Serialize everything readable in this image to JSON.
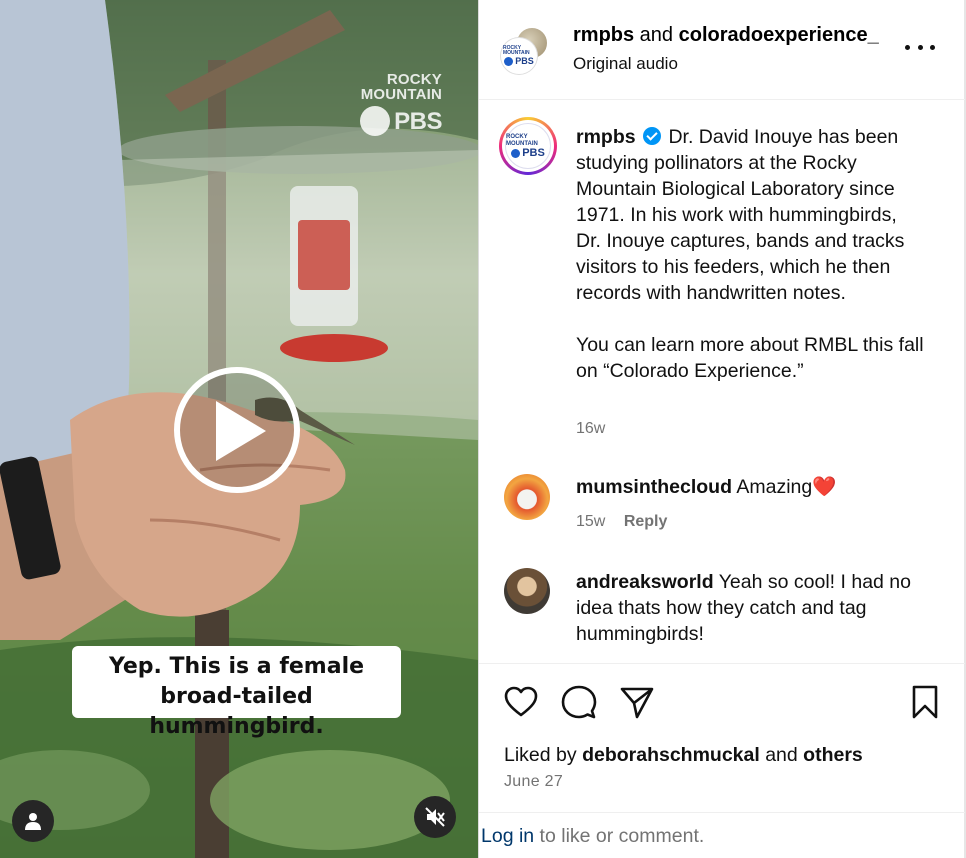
{
  "video": {
    "watermark": {
      "line1": "ROCKY",
      "line2": "MOUNTAIN",
      "brand": "PBS"
    },
    "caption_line1": "Yep. This is a female",
    "caption_line2": "broad-tailed hummingbird.",
    "icons": {
      "play": "play-icon",
      "tags": "user-tag-icon",
      "mute": "speaker-muted-icon"
    }
  },
  "header": {
    "account1": "rmpbs",
    "joiner": " and ",
    "account2": "coloradoexperience_",
    "audio": "Original audio",
    "more_icon": "more-horizontal-icon",
    "avatar_text_top": "ROCKY MOUNTAIN",
    "avatar_text_brand": "PBS"
  },
  "post": {
    "username": "rmpbs",
    "verified_icon": "verified-badge-icon",
    "paragraph1": "Dr. David Inouye has been studying pollinators at the Rocky Mountain Biological Laboratory since 1971. In his work with hummingbirds, Dr. Inouye captures, bands and tracks visitors to his feeders, which he then records with handwritten notes.",
    "paragraph2": "You can learn more about RMBL this fall on “Colorado Experience.”",
    "time": "16w"
  },
  "comments": [
    {
      "username": "mumsinthecloud",
      "text": "Amazing",
      "emoji": "❤️",
      "time": "15w",
      "reply": "Reply"
    },
    {
      "username": "andreaksworld",
      "text": "Yeah so cool! I had no idea thats how they catch and tag hummingbirds!"
    }
  ],
  "actions": {
    "like": "heart-icon",
    "comment": "comment-bubble-icon",
    "share": "paper-plane-icon",
    "save": "bookmark-icon"
  },
  "likes": {
    "prefix": "Liked by ",
    "user": "deborahschmuckal",
    "middle": " and ",
    "others": "others"
  },
  "date": "June 27",
  "login": {
    "link": "Log in",
    "rest": " to like or comment."
  },
  "colors": {
    "link": "#00376b",
    "secondary_text": "#737373",
    "verified": "#0095f6",
    "heart": "#e8143c"
  }
}
